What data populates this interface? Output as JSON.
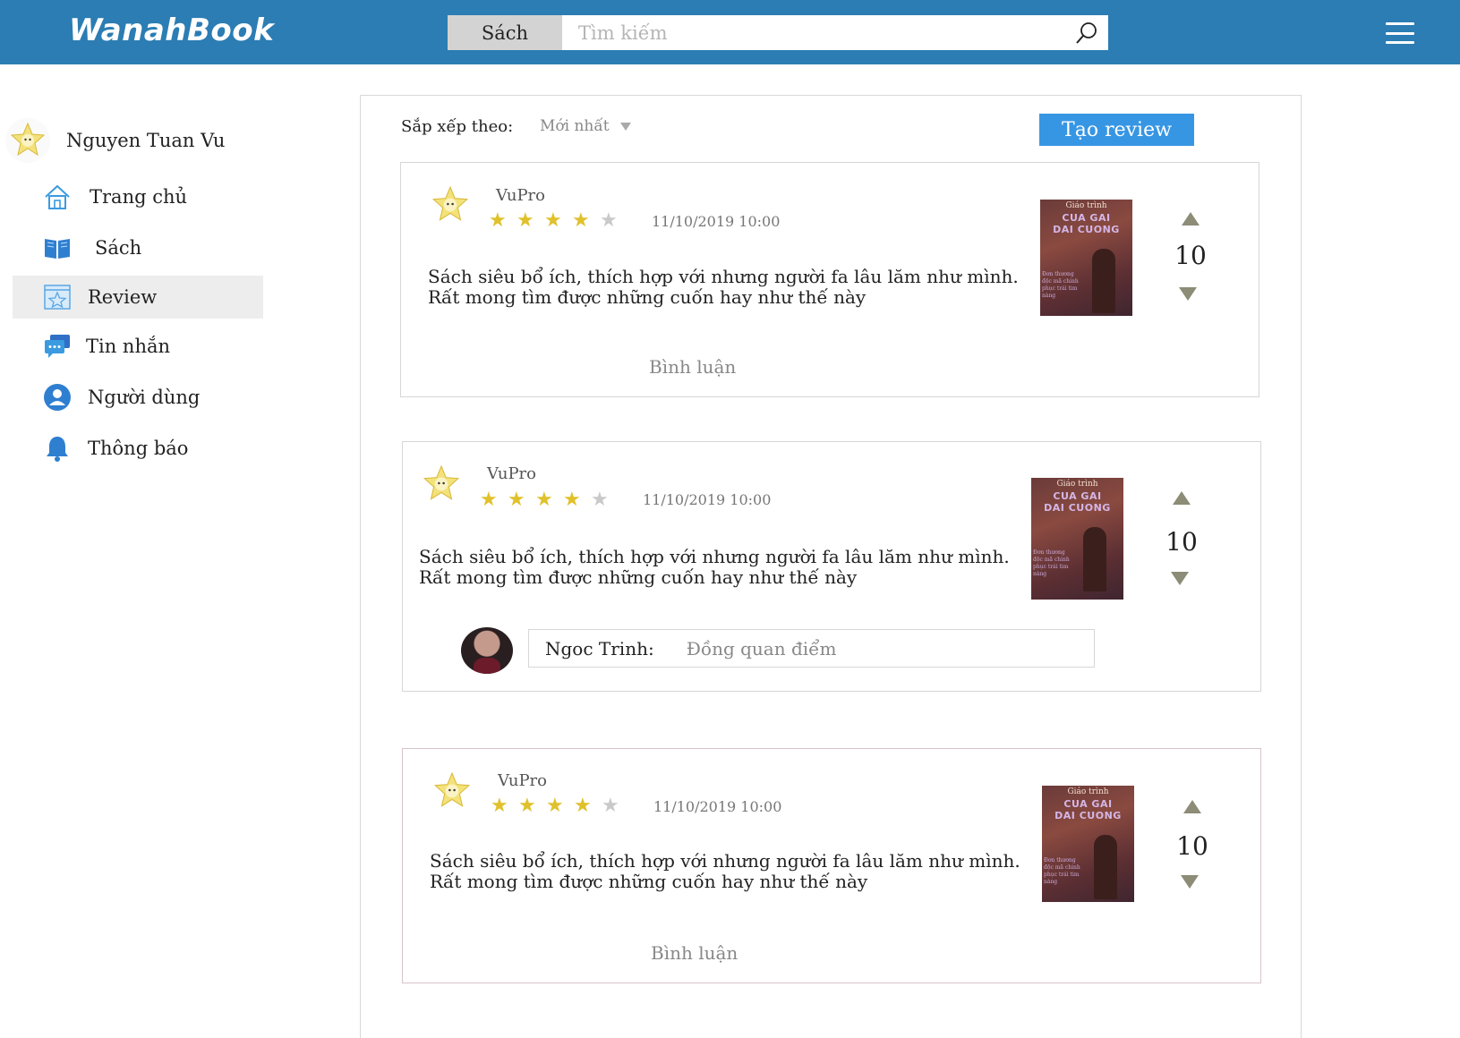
{
  "header": {
    "logo": "WanahBook",
    "search_category": "Sách",
    "search_placeholder": "Tìm kiếm"
  },
  "profile": {
    "name": "Nguyen Tuan Vu"
  },
  "sidebar": {
    "items": [
      {
        "label": "Trang chủ"
      },
      {
        "label": "Sách"
      },
      {
        "label": "Review"
      },
      {
        "label": "Tin nhắn"
      },
      {
        "label": "Người dùng"
      },
      {
        "label": "Thông báo"
      }
    ],
    "active": "Review"
  },
  "toolbar": {
    "sort_label": "Sắp xếp theo:",
    "sort_value": "Mới nhất",
    "create_label": "Tạo review"
  },
  "cover": {
    "top": "Giáo trình",
    "title_line1": "CUA GAI",
    "title_line2": "DAI CUONG",
    "side": "Đơn thương độc mã chinh phục trái tim nàng"
  },
  "reviews": [
    {
      "user": "VuPro",
      "rating": 4,
      "max_rating": 5,
      "date": "11/10/2019 10:00",
      "text_line1": "Sách siêu bổ ích, thích hợp với nhưng người fa lâu lăm như mình.",
      "text_line2": "Rất mong tìm được những cuốn hay như thế này",
      "votes": "10",
      "comment_link": "Bình luận"
    },
    {
      "user": "VuPro",
      "rating": 4,
      "max_rating": 5,
      "date": "11/10/2019 10:00",
      "text_line1": "Sách siêu bổ ích, thích hợp với nhưng người fa lâu lăm như mình.",
      "text_line2": "Rất mong tìm được những cuốn hay như thế này",
      "votes": "10",
      "reply": {
        "name": "Ngoc Trinh:",
        "text": "Đồng quan điểm"
      }
    },
    {
      "user": "VuPro",
      "rating": 4,
      "max_rating": 5,
      "date": "11/10/2019 10:00",
      "text_line1": "Sách siêu bổ ích, thích hợp với nhưng người fa lâu lăm như mình.",
      "text_line2": "Rất mong tìm được những cuốn hay như thế này",
      "votes": "10",
      "comment_link": "Bình luận"
    }
  ],
  "colors": {
    "header_bg": "#2b7db3",
    "accent_button": "#3796e3",
    "star_on": "#e0c12a",
    "star_off": "#c9c9c9",
    "vote_arrow": "#8c8c77",
    "active_nav_bg": "#ededed"
  },
  "icons": {
    "search": "search-icon",
    "menu": "hamburger-menu-icon",
    "home": "home-icon",
    "book": "book-icon",
    "review": "review-star-icon",
    "message": "chat-icon",
    "user": "user-icon",
    "bell": "bell-icon"
  }
}
